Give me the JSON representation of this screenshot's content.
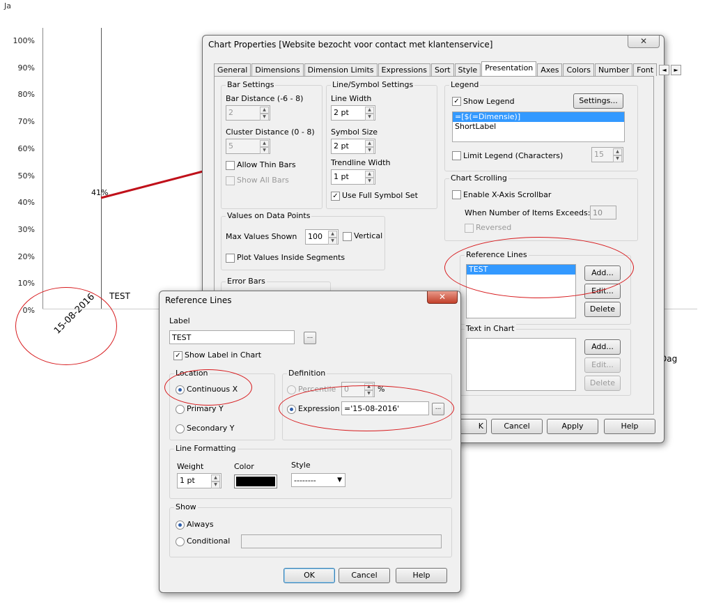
{
  "chart": {
    "corner_label": "Ja",
    "y_ticks": [
      "100%",
      "90%",
      "80%",
      "70%",
      "60%",
      "50%",
      "40%",
      "30%",
      "20%",
      "10%",
      "0%"
    ],
    "point_label": "41%",
    "refline_label": "TEST",
    "x_date": "15-08-2016",
    "x_right_fragment": "Dag",
    "line_color": "#c0101a"
  },
  "chart_props": {
    "title": "Chart Properties [Website bezocht voor contact met klantenservice]",
    "close_glyph": "✕",
    "tabs": [
      "General",
      "Dimensions",
      "Dimension Limits",
      "Expressions",
      "Sort",
      "Style",
      "Presentation",
      "Axes",
      "Colors",
      "Number",
      "Font"
    ],
    "tab_left": "◄",
    "tab_right": "►",
    "bar_settings": {
      "title": "Bar Settings",
      "bar_distance_label": "Bar Distance (-6 - 8)",
      "bar_distance_value": "2",
      "cluster_distance_label": "Cluster Distance (0 - 8)",
      "cluster_distance_value": "5",
      "allow_thin_bars": "Allow Thin Bars",
      "show_all_bars": "Show All Bars"
    },
    "line_symbol": {
      "title": "Line/Symbol Settings",
      "line_width_label": "Line Width",
      "line_width_value": "2 pt",
      "symbol_size_label": "Symbol Size",
      "symbol_size_value": "2 pt",
      "trendline_label": "Trendline Width",
      "trendline_value": "1 pt",
      "use_full_symbol_set": "Use Full Symbol Set"
    },
    "values_on_points": {
      "title": "Values on Data Points",
      "max_values_label": "Max Values Shown",
      "max_values_value": "100",
      "vertical": "Vertical",
      "plot_inside": "Plot Values Inside Segments"
    },
    "error_bars": {
      "title": "Error Bars"
    },
    "legend": {
      "title": "Legend",
      "show_legend": "Show Legend",
      "settings_btn": "Settings...",
      "items": [
        "=[$(=Dimensie)]",
        "ShortLabel"
      ],
      "limit_legend": "Limit Legend (Characters)",
      "limit_value": "15"
    },
    "scrolling": {
      "title": "Chart Scrolling",
      "enable": "Enable X-Axis Scrollbar",
      "when_label": "When Number of Items Exceeds:",
      "when_value": "10",
      "reversed": "Reversed"
    },
    "reference_lines": {
      "title": "Reference Lines",
      "items": [
        "TEST"
      ],
      "add": "Add...",
      "edit": "Edit...",
      "delete": "Delete"
    },
    "text_in_chart": {
      "title": "Text in Chart",
      "add": "Add...",
      "edit": "Edit...",
      "delete": "Delete"
    },
    "bottom_buttons": {
      "ok_fragment": "K",
      "cancel": "Cancel",
      "apply": "Apply",
      "help": "Help"
    }
  },
  "ref_dialog": {
    "title": "Reference Lines",
    "close_glyph": "✕",
    "label_group": "Label",
    "label_value": "TEST",
    "show_label": "Show Label in Chart",
    "location_group": "Location",
    "loc_continuous": "Continuous X",
    "loc_primary": "Primary Y",
    "loc_secondary": "Secondary Y",
    "definition_group": "Definition",
    "percentile_label": "Percentile",
    "percentile_value": "0",
    "percent_sign": "%",
    "expression_label": "Expression",
    "expression_value": "='15-08-2016'",
    "line_formatting_group": "Line Formatting",
    "weight_label": "Weight",
    "weight_value": "1 pt",
    "color_label": "Color",
    "style_label": "Style",
    "style_value": "--------",
    "line_color": "#000000",
    "show_group": "Show",
    "show_always": "Always",
    "show_conditional": "Conditional",
    "ok": "OK",
    "cancel": "Cancel",
    "help": "Help"
  },
  "colors": {
    "annotation": "#d7191c",
    "selection": "#3399ff"
  }
}
